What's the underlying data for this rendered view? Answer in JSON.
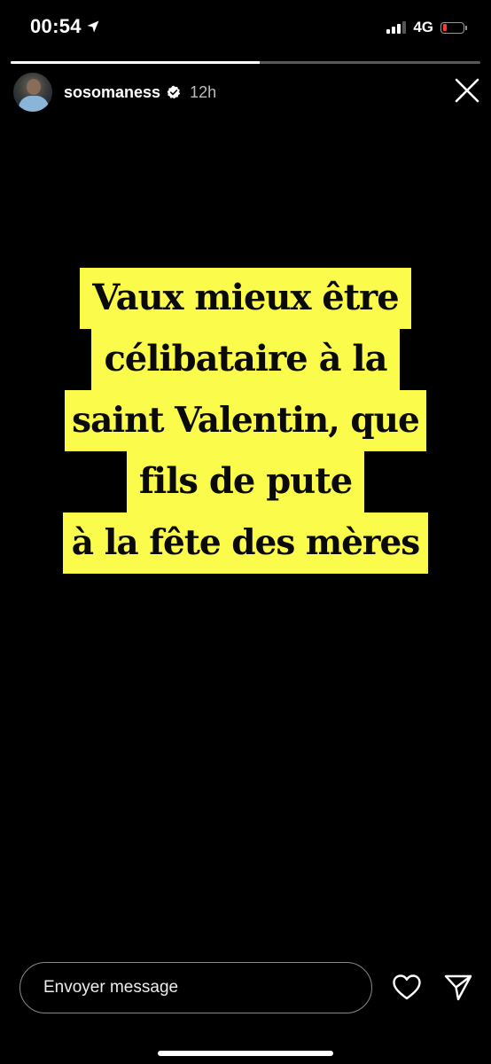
{
  "status_bar": {
    "time": "00:54",
    "network": "4G",
    "location_icon": "location-arrow-icon",
    "battery_color": "#ff3b30"
  },
  "story": {
    "progress": 0.53,
    "username": "sosomaness",
    "verified": true,
    "time_ago": "12h",
    "close_icon": "close-icon"
  },
  "quote": {
    "highlight_color": "#fbfb4c",
    "lines": [
      "Vaux mieux être",
      "célibataire à la",
      "saint Valentin, que",
      "fils de pute",
      "à la fête des mères"
    ]
  },
  "footer": {
    "message_placeholder": "Envoyer message",
    "like_icon": "heart-icon",
    "send_icon": "send-icon"
  }
}
